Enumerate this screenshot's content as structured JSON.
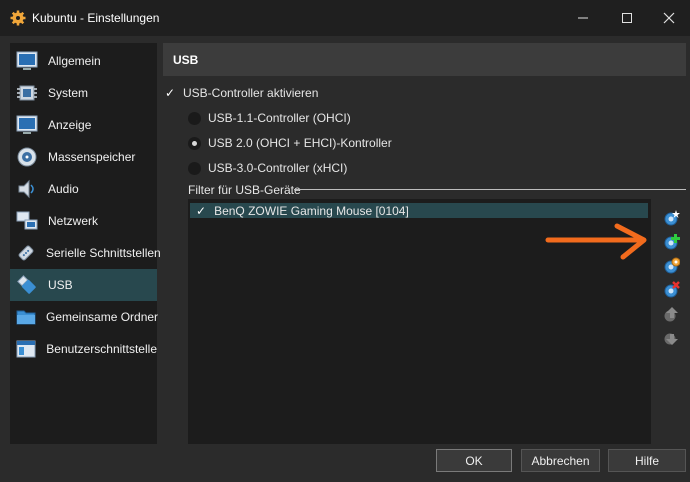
{
  "window": {
    "title": "Kubuntu - Einstellungen"
  },
  "sidebar": {
    "items": [
      {
        "label": "Allgemein",
        "icon": "general-icon"
      },
      {
        "label": "System",
        "icon": "system-chip-icon"
      },
      {
        "label": "Anzeige",
        "icon": "display-icon"
      },
      {
        "label": "Massenspeicher",
        "icon": "storage-icon"
      },
      {
        "label": "Audio",
        "icon": "audio-icon"
      },
      {
        "label": "Netzwerk",
        "icon": "network-icon"
      },
      {
        "label": "Serielle Schnittstellen",
        "icon": "serial-port-icon"
      },
      {
        "label": "USB",
        "icon": "usb-icon",
        "active": true
      },
      {
        "label": "Gemeinsame Ordner",
        "icon": "shared-folder-icon"
      },
      {
        "label": "Benutzerschnittstelle",
        "icon": "user-interface-icon"
      }
    ]
  },
  "header": {
    "title": "USB"
  },
  "usb": {
    "enable_label": "USB-Controller aktivieren",
    "enable_checked": true,
    "radios": [
      {
        "label": "USB-1.1-Controller (OHCI)",
        "selected": false
      },
      {
        "label": "USB 2.0 (OHCI + EHCI)-Kontroller",
        "selected": true
      },
      {
        "label": "USB-3.0-Controller (xHCI)",
        "selected": false
      }
    ]
  },
  "filters": {
    "title": "Filter für USB-Geräte",
    "items": [
      {
        "label": "BenQ ZOWIE Gaming Mouse [0104]",
        "checked": true
      }
    ]
  },
  "toolbar": {
    "buttons": [
      {
        "name": "add-empty-filter-button",
        "icon": "usb-filter-add-empty-icon",
        "enabled": true
      },
      {
        "name": "add-device-filter-button",
        "icon": "usb-filter-add-device-icon",
        "enabled": true
      },
      {
        "name": "edit-filter-button",
        "icon": "usb-filter-edit-icon",
        "enabled": true
      },
      {
        "name": "remove-filter-button",
        "icon": "usb-filter-remove-icon",
        "enabled": true
      },
      {
        "name": "move-filter-up-button",
        "icon": "arrow-up-icon",
        "enabled": false
      },
      {
        "name": "move-filter-down-button",
        "icon": "arrow-down-icon",
        "enabled": false
      }
    ]
  },
  "footer": {
    "ok": "OK",
    "cancel": "Abbrechen",
    "help": "Hilfe"
  },
  "colors": {
    "accent": "#28484e",
    "annotation": "#f26b1d"
  }
}
